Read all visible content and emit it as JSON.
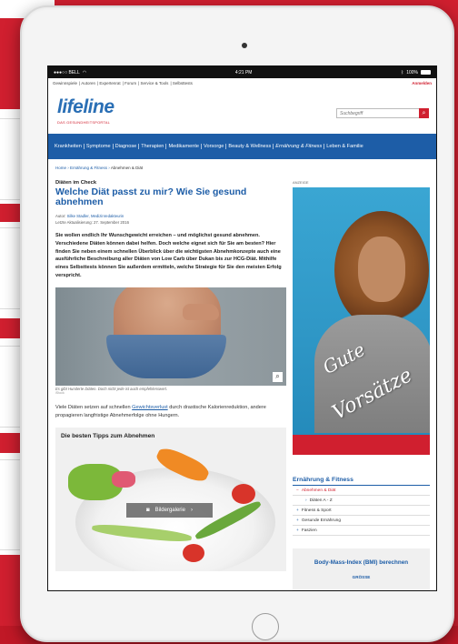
{
  "status": {
    "carrier": "●●●○○ BELL",
    "wifi": "wifi-icon",
    "time": "4:21 PM",
    "bluetooth": "bluetooth-icon",
    "battery": "100%"
  },
  "topnav": {
    "links": [
      "Gewinnspiele",
      "Autoren",
      "Expertenrat",
      "Forum",
      "Service & Tools",
      "Selbsttests"
    ],
    "login": "Anmelden"
  },
  "brand": {
    "logo": "lifeline",
    "tagline": "DAS GESUNDHEITSPORTAL"
  },
  "search": {
    "placeholder": "Suchbegriff",
    "icon": "search-icon"
  },
  "mainnav": [
    "Krankheiten",
    "Symptome",
    "Diagnose",
    "Therapien",
    "Medikamente",
    "Vorsorge",
    "Beauty & Wellness",
    "Ernährung & Fitness",
    "Leben & Familie"
  ],
  "breadcrumb": {
    "home": "Home",
    "section": "Ernährung & Fitness",
    "current": "Abnehmen & Diät"
  },
  "article": {
    "kicker": "Diäten im Check",
    "headline": "Welche Diät passt zu mir? Wie Sie gesund abnehmen",
    "author_label": "Autor:",
    "author": "Silke Stadler, Medizinredakteurin",
    "updated": "Letzte Aktualisierung: 27. September 2016",
    "intro": "Sie wollen endlich Ihr Wunschgewicht erreichen – und möglichst gesund abnehmen. Verschiedene Diäten können dabei helfen. Doch welche eignet sich für Sie am besten? Hier finden Sie neben einem schnellen Überblick über die wichtigsten Abnehmkonzepte auch eine ausführliche Beschreibung aller Diäten von Low Carb über Dukan bis zur HCG-Diät. Mithilfe eines Selbsttests können Sie außerdem ermitteln, welche Strategie für Sie den meisten Erfolg verspricht.",
    "caption": "Es gibt Hunderte Diäten. Doch nicht jede ist auch empfehlenswert.",
    "credit": "iStock",
    "body_pre": "Viele Diäten setzen auf schnellen ",
    "body_link": "Gewichtsverlust",
    "body_post": " durch drastische Kalorienreduktion, andere propagieren langfristige Abnehmerfolge ohne Hungern.",
    "tips_title": "Die besten Tipps zum Abnehmen",
    "gallery_label": "Bildergalerie"
  },
  "ad": {
    "label": "ANZEIGE",
    "line1": "Gute",
    "line2": "Vorsätze"
  },
  "sidenav": {
    "title": "Ernährung & Fitness",
    "items": [
      {
        "marker": "−",
        "label": "Abnehmen & Diät",
        "active": true,
        "sub": false
      },
      {
        "marker": "›",
        "label": "Diäten A - Z",
        "active": false,
        "sub": true
      },
      {
        "marker": "+",
        "label": "Fitness & Sport",
        "active": false,
        "sub": false
      },
      {
        "marker": "+",
        "label": "Gesunde Ernährung",
        "active": false,
        "sub": false
      },
      {
        "marker": "+",
        "label": "Faszien",
        "active": false,
        "sub": false
      }
    ]
  },
  "bmi": {
    "title": "Body-Mass-Index (BMI) berechnen",
    "sub": "GRÖSSE"
  },
  "colors": {
    "brand_blue": "#1d5da7",
    "brand_red": "#d01f2f"
  }
}
